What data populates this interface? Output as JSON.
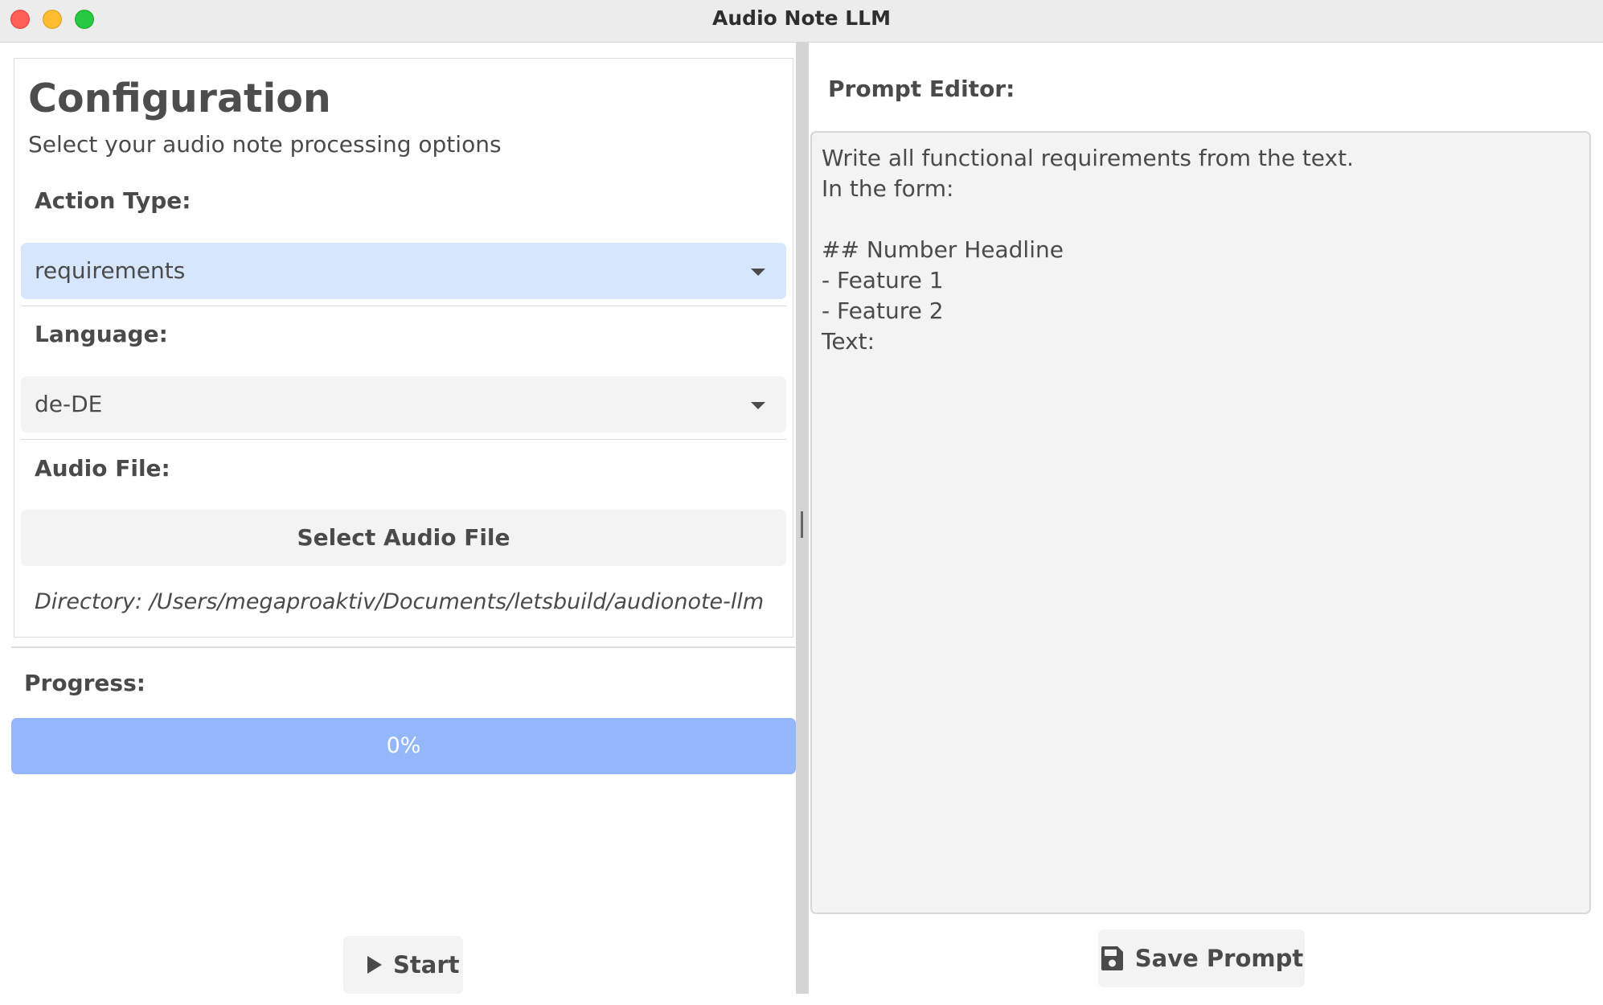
{
  "window": {
    "title": "Audio Note LLM"
  },
  "config": {
    "title": "Configuration",
    "subtitle": "Select your audio note processing options",
    "action_type": {
      "label": "Action Type:",
      "value": "requirements"
    },
    "language": {
      "label": "Language:",
      "value": "de-DE"
    },
    "audio_file": {
      "label": "Audio File:",
      "button_label": "Select Audio File",
      "directory": "Directory: /Users/megaproaktiv/Documents/letsbuild/audionote-llm"
    }
  },
  "progress": {
    "label": "Progress:",
    "value": 0,
    "text": "0%"
  },
  "start_button": {
    "label": "Start",
    "icon": "play-icon"
  },
  "prompt": {
    "label": "Prompt Editor:",
    "text": "Write all functional requirements from the text.\nIn the form:\n\n## Number Headline\n- Feature 1\n- Feature 2\nText:",
    "save_label": "Save Prompt",
    "save_icon": "floppy-disk-icon"
  },
  "colors": {
    "accent_light": "#d6e6fd",
    "progress_fill": "#94b6fb",
    "button_bg": "#f3f3f3",
    "text": "#4a4a4a"
  }
}
